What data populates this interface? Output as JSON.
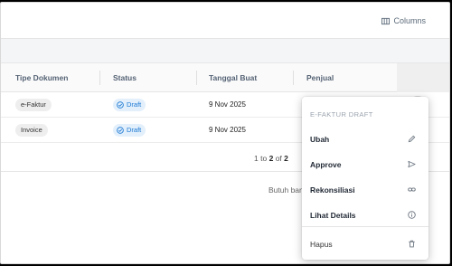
{
  "toolbar": {
    "columns_label": "Columns"
  },
  "table": {
    "headers": [
      "Tipe Dokumen",
      "Status",
      "Tanggal Buat",
      "Penjual"
    ],
    "rows": [
      {
        "tipe": "e-Faktur",
        "status": "Draft",
        "tanggal": "9 Nov 2025"
      },
      {
        "tipe": "Invoice",
        "status": "Draft",
        "tanggal": "9 Nov 2025"
      }
    ]
  },
  "pagination": {
    "from": "1",
    "to_word": "to",
    "to": "2",
    "of_word": "of",
    "total": "2"
  },
  "help_text": "Butuh ban",
  "menu": {
    "header": "E-FAKTUR DRAFT",
    "items": [
      {
        "label": "Ubah",
        "icon": "edit-icon"
      },
      {
        "label": "Approve",
        "icon": "send-icon"
      },
      {
        "label": "Rekonsiliasi",
        "icon": "link-icon"
      },
      {
        "label": "Lihat Details",
        "icon": "info-icon"
      },
      {
        "label": "Hapus",
        "icon": "trash-icon"
      }
    ]
  },
  "colors": {
    "status_blue": "#1976d2",
    "status_bg": "#e3f0fc",
    "header_text": "#546274"
  }
}
